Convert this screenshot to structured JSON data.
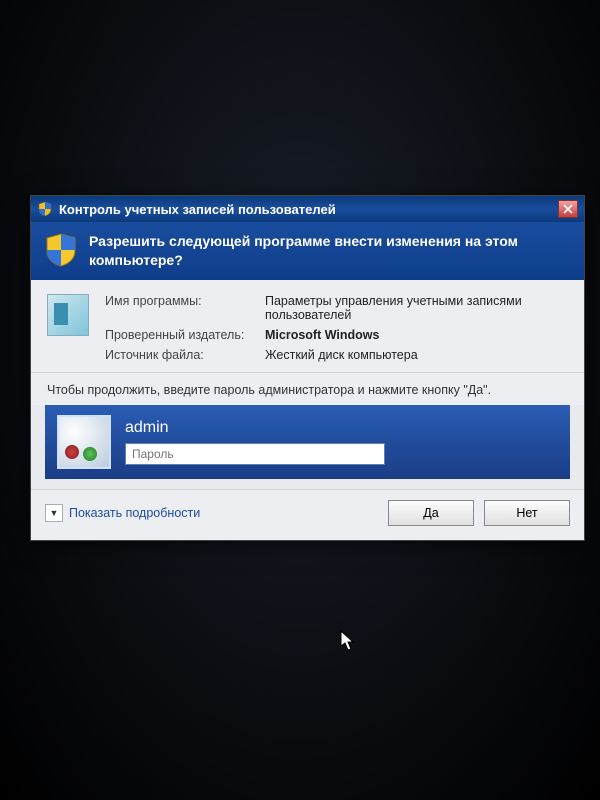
{
  "titlebar": {
    "title": "Контроль учетных записей пользователей"
  },
  "header": {
    "question": "Разрешить следующей программе внести изменения на этом компьютере?"
  },
  "info": {
    "program_name_label": "Имя программы:",
    "program_name_value": "Параметры управления учетными записями пользователей",
    "publisher_label": "Проверенный издатель:",
    "publisher_value": "Microsoft Windows",
    "source_label": "Источник файла:",
    "source_value": "Жесткий диск компьютера"
  },
  "instruction": "Чтобы продолжить, введите пароль администратора и нажмите кнопку \"Да\".",
  "credentials": {
    "username": "admin",
    "password_placeholder": "Пароль"
  },
  "footer": {
    "details_label": "Показать подробности",
    "yes_label": "Да",
    "no_label": "Нет"
  }
}
